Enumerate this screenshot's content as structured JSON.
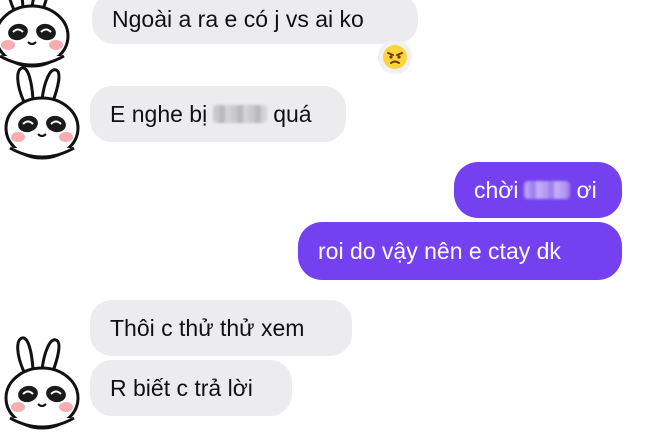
{
  "colors": {
    "incoming_bubble": "#ececef",
    "outgoing_bubble": "#7440f0",
    "background": "#ffffff"
  },
  "messages": [
    {
      "id": "m1",
      "side": "incoming",
      "text": "Ngoài a ra e có j vs ai ko"
    },
    {
      "id": "m2",
      "side": "incoming",
      "text_before": "E nghe bị",
      "text_after": "quá",
      "redacted": true
    },
    {
      "id": "m3",
      "side": "outgoing",
      "text_before": "chời",
      "text_after": "ơi",
      "redacted": true
    },
    {
      "id": "m4",
      "side": "outgoing",
      "text": "roi do vậy nên e ctay dk"
    },
    {
      "id": "m5",
      "side": "incoming",
      "text": "Thôi c thử thử xem"
    },
    {
      "id": "m6",
      "side": "incoming",
      "text": "R biết c trả lời"
    }
  ],
  "reaction": {
    "icon": "angry-face-emoji-icon"
  },
  "avatar": {
    "icon": "panda-bunny-avatar-icon"
  }
}
